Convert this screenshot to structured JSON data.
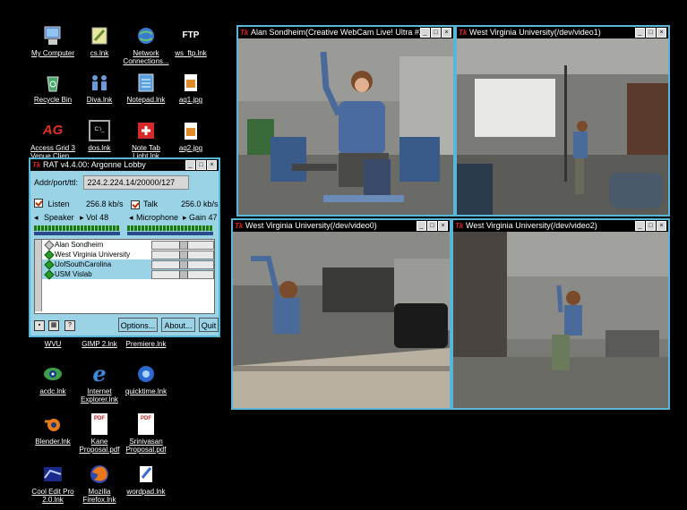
{
  "desktop_icons": [
    {
      "label": "My Computer",
      "icon": "computer-icon"
    },
    {
      "label": "cs.lnk",
      "icon": "shortcut-icon"
    },
    {
      "label": "Network Connections...",
      "icon": "network-icon"
    },
    {
      "label": "ws_ftp.lnk",
      "icon": "ftp-icon",
      "glyph": "FTP"
    },
    {
      "label": "Recycle Bin",
      "icon": "recycle-bin-icon"
    },
    {
      "label": "Diva.lnk",
      "icon": "people-icon"
    },
    {
      "label": "Notepad.lnk",
      "icon": "notepad-icon"
    },
    {
      "label": "aq1.jpg",
      "icon": "jpg-file-icon"
    },
    {
      "label": "Access Grid 3 Venue Clien...",
      "icon": "access-grid-icon",
      "glyph": "AG"
    },
    {
      "label": "dos.lnk",
      "icon": "dos-prompt-icon",
      "glyph": "C:\\_"
    },
    {
      "label": "Note Tab Light.lnk",
      "icon": "notetab-icon"
    },
    {
      "label": "aq2.jpg",
      "icon": "jpg-file-icon"
    },
    {
      "label": "WVU",
      "icon": "folder-icon"
    },
    {
      "label": "GIMP 2.lnk",
      "icon": "gimp-icon"
    },
    {
      "label": "Premiere.lnk",
      "icon": "premiere-icon"
    },
    {
      "label": "acdc.lnk",
      "icon": "acdsee-icon"
    },
    {
      "label": "Internet Explorer.lnk",
      "icon": "internet-explorer-icon",
      "glyph": "e"
    },
    {
      "label": "quicktime.lnk",
      "icon": "quicktime-icon"
    },
    {
      "label": "Blender.lnk",
      "icon": "blender-icon"
    },
    {
      "label": "Kane Proposal.pdf",
      "icon": "pdf-file-icon",
      "glyph": "PDF"
    },
    {
      "label": "Srinivasan Proposal.pdf",
      "icon": "pdf-file-icon",
      "glyph": "PDF"
    },
    {
      "label": "Cool Edit Pro 2.0.lnk",
      "icon": "cool-edit-icon"
    },
    {
      "label": "Mozilla Firefox.lnk",
      "icon": "firefox-icon"
    },
    {
      "label": "wordpad.lnk",
      "icon": "wordpad-icon"
    }
  ],
  "rat": {
    "title": "RAT v4.4.00: Argonne Lobby",
    "tk_logo": "Tk",
    "addr_label": "Addr/port/ttl:",
    "addr_value": "224.2.224.14/20000/127",
    "listen_label": "Listen",
    "listen_rate": "256.8 kb/s",
    "talk_label": "Talk",
    "talk_rate": "256.0 kb/s",
    "speaker_label": "Speaker",
    "vol_label": "Vol 48",
    "microphone_label": "Microphone",
    "gain_label": "Gain 47",
    "participants": [
      "Alan Sondheim",
      "West Virginia University",
      "UofSouthCarolina",
      "USM Vislab"
    ],
    "options_label": "Options...",
    "about_label": "About...",
    "quit_label": "Quit",
    "help_glyph": "?"
  },
  "video_windows": [
    {
      "title": "Alan Sondheim(Creative WebCam Live! Ultra #2)"
    },
    {
      "title": "West Virginia University(/dev/video1)"
    },
    {
      "title": "West Virginia University(/dev/video0)"
    },
    {
      "title": "West Virginia University(/dev/video2)"
    }
  ],
  "window_buttons": {
    "minimize": "_",
    "maximize": "□",
    "close": "×"
  }
}
